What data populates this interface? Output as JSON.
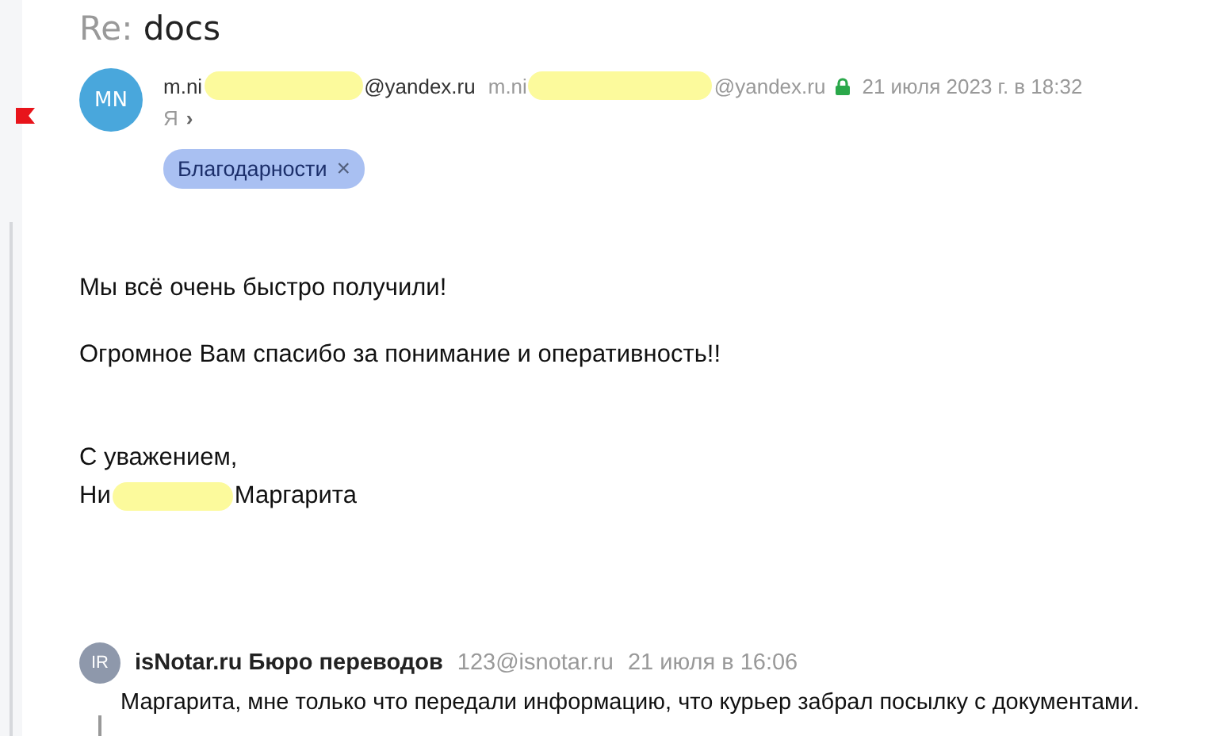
{
  "subject": {
    "prefix": "Re:",
    "title": "docs"
  },
  "message": {
    "avatar": "MN",
    "from_start": "m.ni",
    "from_end": "@yandex.ru",
    "to_start": "m.ni",
    "to_end": "@yandex.ru",
    "secure": true,
    "date": "21 июля 2023 г. в 18:32",
    "recipient": "Я",
    "recipient_arrow": "›",
    "tags": [
      {
        "label": "Благодарности",
        "remove": "×"
      }
    ],
    "paragraphs": [
      "Мы всё очень быстро получили!",
      "Огромное Вам спасибо за понимание и оперативность!!"
    ],
    "signature": {
      "greeting": "С уважением,",
      "name_start": "Ни",
      "name_end": "Маргарита"
    }
  },
  "quoted": {
    "avatar": "IR",
    "sender": "isNotar.ru Бюро переводов",
    "email": "123@isnotar.ru",
    "date": "21 июля в 16:06",
    "snippet": "Маргарита, мне только что передали информацию, что курьер забрал посылку с документами."
  }
}
